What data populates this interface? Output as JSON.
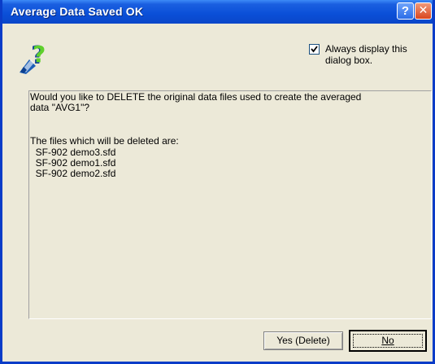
{
  "window": {
    "title": "Average Data Saved OK",
    "help_label": "?",
    "close_label": "✕"
  },
  "header": {
    "icon": "help-question-icon",
    "always_display": {
      "checked": true,
      "label": "Always display this dialog box."
    }
  },
  "message": {
    "lines": [
      "Would you like to DELETE the original data files used to create the averaged",
      "data \"AVG1\"?",
      "The files which will be deleted are:",
      "  SF-902 demo3.sfd",
      "  SF-902 demo1.sfd",
      "  SF-902 demo2.sfd"
    ]
  },
  "buttons": {
    "yes_label": "Yes (Delete)",
    "no_label": "No"
  },
  "colors": {
    "titlebar": "#0a4fd8",
    "frame": "#0a3cc8",
    "dialog_bg": "#ece9d8"
  }
}
